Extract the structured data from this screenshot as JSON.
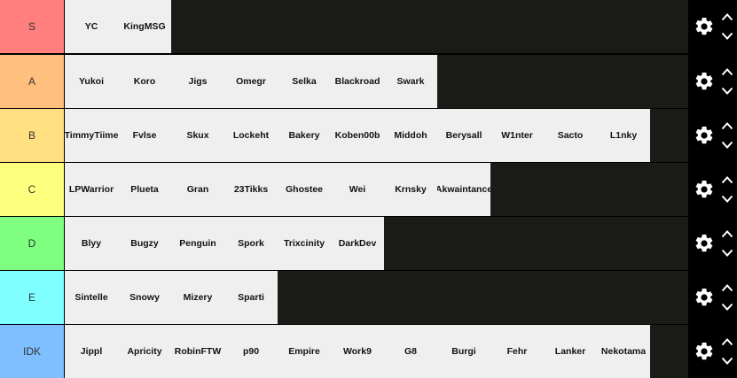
{
  "colors": {
    "S": "#ff7f7f",
    "A": "#ffbf7f",
    "B": "#ffdf7f",
    "C": "#ffff7f",
    "D": "#7fff7f",
    "E": "#7fffff",
    "IDK": "#7fbfff",
    "row_background": "#1a1a17",
    "item_background": "#efefef",
    "controls_background": "#000000"
  },
  "icons": {
    "settings": "gear-icon",
    "move_up": "chevron-up-icon",
    "move_down": "chevron-down-icon"
  },
  "tiers": [
    {
      "label": "S",
      "items": [
        "YC",
        "KingMSG"
      ]
    },
    {
      "label": "A",
      "items": [
        "Yukoi",
        "Koro",
        "Jigs",
        "Omegr",
        "Selka",
        "Blackroad",
        "Swark"
      ]
    },
    {
      "label": "B",
      "items": [
        "TimmyTiime",
        "Fvlse",
        "Skux",
        "Lockeht",
        "Bakery",
        "Koben00b",
        "Middoh",
        "Berysall",
        "W1nter",
        "Sacto",
        "L1nky"
      ]
    },
    {
      "label": "C",
      "items": [
        "LPWarrior",
        "Plueta",
        "Gran",
        "23Tikks",
        "Ghostee",
        "Wei",
        "Krnsky",
        "Akwaintance"
      ]
    },
    {
      "label": "D",
      "items": [
        "Blyy",
        "Bugzy",
        "Penguin",
        "Spork",
        "Trixcinity",
        "DarkDev"
      ]
    },
    {
      "label": "E",
      "items": [
        "Sintelle",
        "Snowy",
        "Mizery",
        "Sparti"
      ]
    },
    {
      "label": "IDK",
      "items": [
        "Jippl",
        "Apricity",
        "RobinFTW",
        "p90",
        "Empire",
        "Work9",
        "G8",
        "Burgi",
        "Fehr",
        "Lanker",
        "Nekotama"
      ]
    }
  ]
}
